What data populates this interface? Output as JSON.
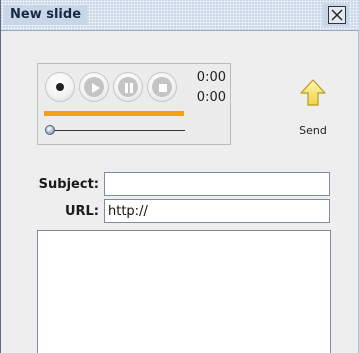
{
  "window": {
    "title": "New slide"
  },
  "recorder": {
    "elapsed_time": "0:00",
    "total_time": "0:00",
    "progress_color": "#f5a019",
    "buttons": [
      "record",
      "play",
      "pause",
      "stop"
    ]
  },
  "send": {
    "label": "Send",
    "icon": "up-arrow-icon"
  },
  "form": {
    "subject_label": "Subject:",
    "subject_value": "",
    "url_label": "URL:",
    "url_value": "http://",
    "body_value": ""
  }
}
